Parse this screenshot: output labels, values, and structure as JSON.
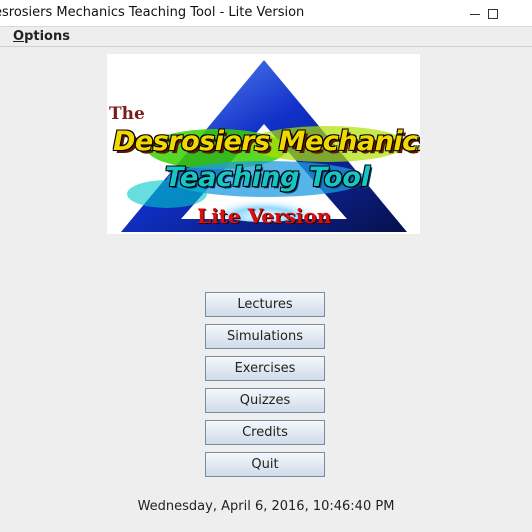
{
  "window": {
    "title": "esrosiers Mechanics Teaching Tool - Lite Version"
  },
  "menu": {
    "options_mnemonic": "O",
    "options_rest": "ptions"
  },
  "logo": {
    "the": "The",
    "line1": "Desrosiers Mechanics",
    "line2": "Teaching Tool",
    "line3": "Lite Version"
  },
  "buttons": {
    "lectures": "Lectures",
    "simulations": "Simulations",
    "exercises": "Exercises",
    "quizzes": "Quizzes",
    "credits": "Credits",
    "quit": "Quit"
  },
  "datetime": "Wednesday, April 6, 2016, 10:46:40 PM",
  "colors": {
    "background": "#eeeeee",
    "button_top": "#f4f8fc",
    "button_bottom": "#cfdbe9",
    "logo_red": "#d81010",
    "logo_yellow": "#f3d800",
    "logo_cyan": "#16c6c6",
    "triangle_blue": "#1030c8"
  }
}
